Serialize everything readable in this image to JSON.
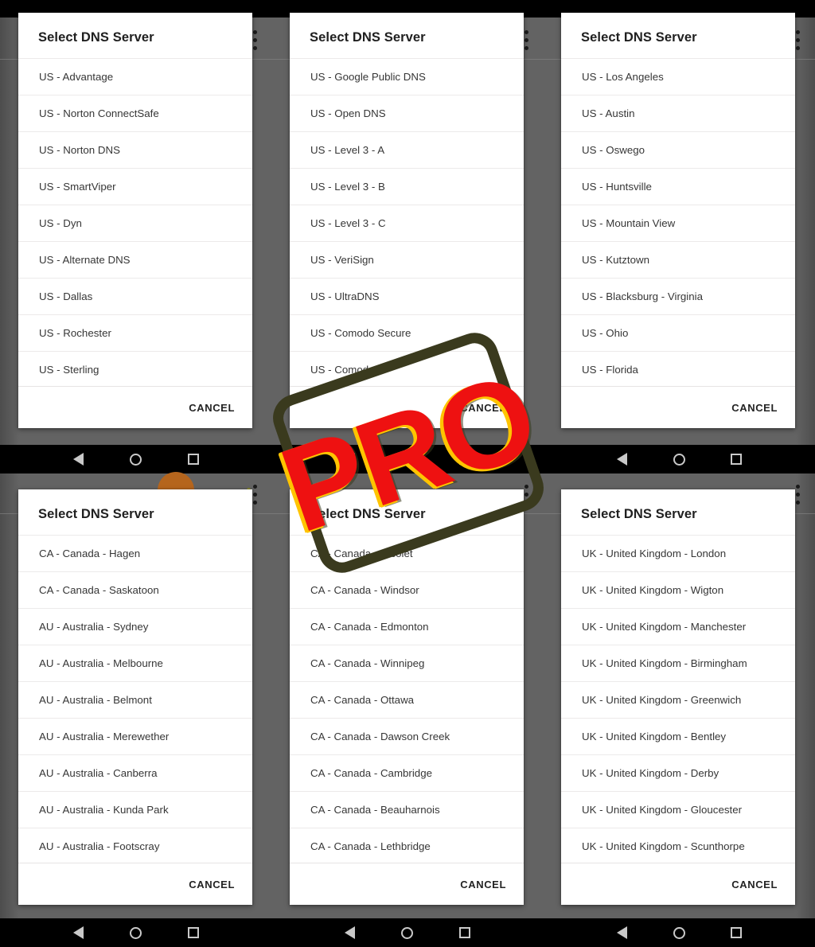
{
  "dialog_title": "Select DNS Server",
  "cancel_label": "CANCEL",
  "watermark": {
    "text": "PRO",
    "color": "#ee1111",
    "accent": "#ffc400",
    "frame_color": "#3a3a1e"
  },
  "nav_bar": {
    "back": "back-icon",
    "home": "home-icon",
    "recents": "recents-icon"
  },
  "colors": {
    "scrim": "#636363",
    "status_bar": "#000000",
    "nav_bar": "#000000",
    "dialog_bg": "#ffffff",
    "divider": "#eceaea",
    "text": "#363636",
    "title": "#202020",
    "avatar": "#b5651d"
  },
  "panels": [
    {
      "title": "Select DNS Server",
      "cancel": "CANCEL",
      "items": [
        "US - Advantage",
        "US - Norton ConnectSafe",
        "US - Norton DNS",
        "US - SmartViper",
        "US - Dyn",
        "US - Alternate DNS",
        "US - Dallas",
        "US - Rochester",
        "US - Sterling"
      ]
    },
    {
      "title": "Select DNS Server",
      "cancel": "CANCEL",
      "items": [
        "US - Google Public DNS",
        "US - Open DNS",
        "US - Level 3 - A",
        "US - Level 3 - B",
        "US - Level 3 - C",
        "US - VeriSign",
        "US - UltraDNS",
        "US - Comodo Secure",
        "US - Comodo"
      ]
    },
    {
      "title": "Select DNS Server",
      "cancel": "CANCEL",
      "items": [
        "US - Los Angeles",
        "US - Austin",
        "US - Oswego",
        "US - Huntsville",
        "US - Mountain View",
        "US - Kutztown",
        "US - Blacksburg - Virginia",
        "US - Ohio",
        "US - Florida"
      ]
    },
    {
      "title": "Select DNS Server",
      "cancel": "CANCEL",
      "items": [
        "CA - Canada - Hagen",
        "CA - Canada - Saskatoon",
        "AU - Australia - Sydney",
        "AU - Australia - Melbourne",
        "AU - Australia - Belmont",
        "AU - Australia - Merewether",
        "AU - Australia - Canberra",
        "AU - Australia - Kunda Park",
        "AU - Australia - Footscray"
      ]
    },
    {
      "title": "Select DNS Server",
      "cancel": "CANCEL",
      "items": [
        "CA - Canada - Nicolet",
        "CA - Canada - Windsor",
        "CA - Canada - Edmonton",
        "CA - Canada - Winnipeg",
        "CA - Canada - Ottawa",
        "CA - Canada - Dawson Creek",
        "CA - Canada - Cambridge",
        "CA - Canada - Beauharnois",
        "CA - Canada - Lethbridge"
      ]
    },
    {
      "title": "Select DNS Server",
      "cancel": "CANCEL",
      "items": [
        "UK - United Kingdom - London",
        "UK - United Kingdom - Wigton",
        "UK - United Kingdom - Manchester",
        "UK - United Kingdom - Birmingham",
        "UK - United Kingdom - Greenwich",
        "UK - United Kingdom - Bentley",
        "UK - United Kingdom - Derby",
        "UK - United Kingdom - Gloucester",
        "UK - United Kingdom - Scunthorpe"
      ]
    }
  ]
}
